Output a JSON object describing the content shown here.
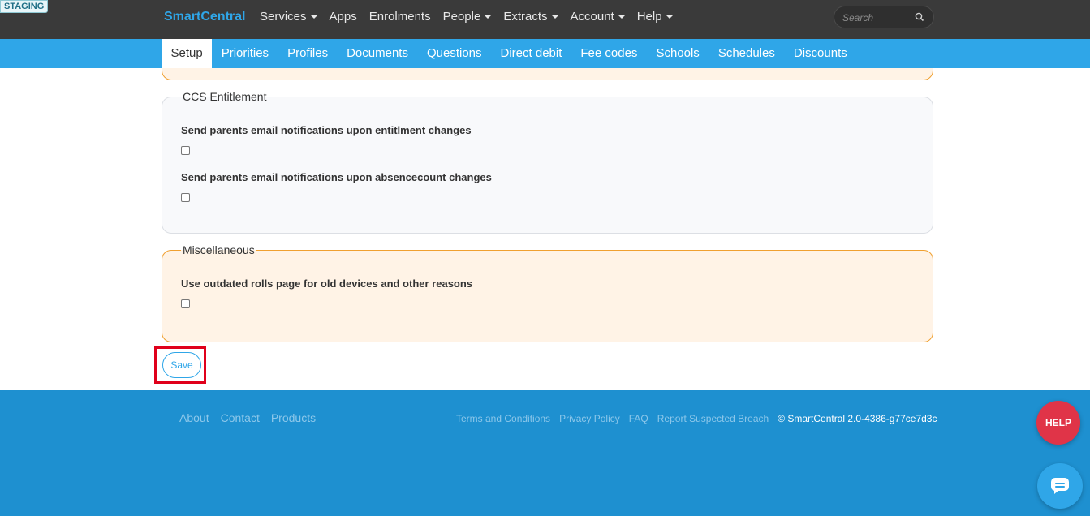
{
  "badge": {
    "staging": "STAGING"
  },
  "brand": {
    "name": "SmartCentral"
  },
  "nav": {
    "items": [
      {
        "label": "Services",
        "dropdown": true
      },
      {
        "label": "Apps",
        "dropdown": false
      },
      {
        "label": "Enrolments",
        "dropdown": false
      },
      {
        "label": "People",
        "dropdown": true
      },
      {
        "label": "Extracts",
        "dropdown": true
      },
      {
        "label": "Account",
        "dropdown": true
      },
      {
        "label": "Help",
        "dropdown": true
      }
    ]
  },
  "search": {
    "placeholder": "Search"
  },
  "tabs": [
    {
      "label": "Setup",
      "active": true
    },
    {
      "label": "Priorities"
    },
    {
      "label": "Profiles"
    },
    {
      "label": "Documents"
    },
    {
      "label": "Questions"
    },
    {
      "label": "Direct debit"
    },
    {
      "label": "Fee codes"
    },
    {
      "label": "Schools"
    },
    {
      "label": "Schedules"
    },
    {
      "label": "Discounts"
    }
  ],
  "ccs": {
    "legend": "CCS Entitlement",
    "fields": [
      {
        "label": "Send parents email notifications upon entitlment changes",
        "checked": false
      },
      {
        "label": "Send parents email notifications upon absencecount changes",
        "checked": false
      }
    ]
  },
  "misc": {
    "legend": "Miscellaneous",
    "fields": [
      {
        "label": "Use outdated rolls page for old devices and other reasons",
        "checked": false
      }
    ]
  },
  "save": {
    "label": "Save"
  },
  "footer": {
    "left_links": [
      "About",
      "Contact",
      "Products"
    ],
    "right_links": [
      "Terms and Conditions",
      "Privacy Policy",
      "FAQ",
      "Report Suspected Breach"
    ],
    "copyright": "© SmartCentral 2.0-4386-g77ce7d3c"
  },
  "help_button": {
    "label": "HELP"
  },
  "colors": {
    "brand": "#2fa6e8",
    "nav_bg": "#3a3a3a",
    "footer_bg": "#1e90d0",
    "help": "#e03448",
    "highlight": "#e0001b"
  },
  "icons": {
    "search": "search-icon",
    "chat": "chat-icon",
    "caret": "caret-down-icon"
  }
}
